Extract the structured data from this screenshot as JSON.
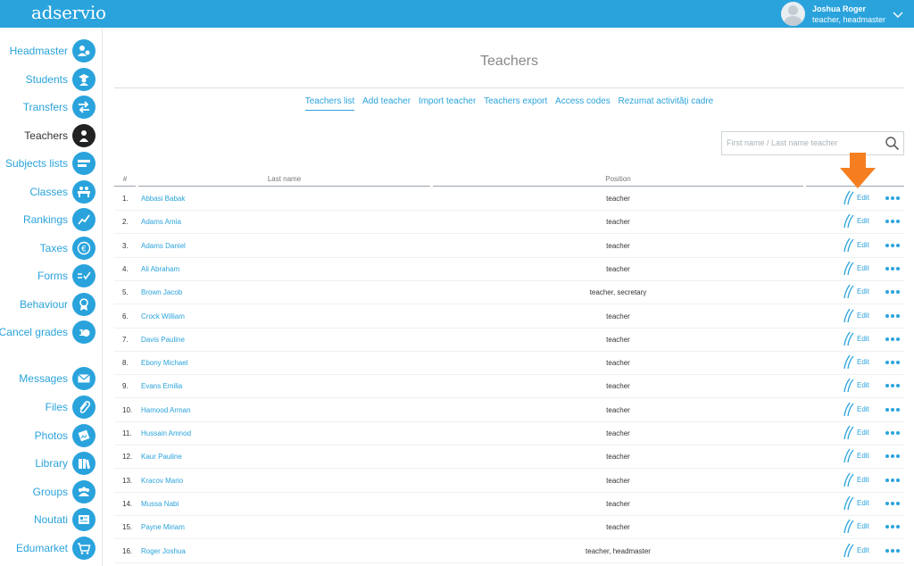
{
  "app": {
    "logo": "adservio"
  },
  "user": {
    "name": "Joshua Roger",
    "role": "teacher, headmaster"
  },
  "colors": {
    "accent": "#2aa3dc",
    "arrow": "#f57f20"
  },
  "sidebar": {
    "items": [
      {
        "label": "Headmaster",
        "icon": "headmaster-icon"
      },
      {
        "label": "Students",
        "icon": "student-icon"
      },
      {
        "label": "Transfers",
        "icon": "transfer-icon"
      },
      {
        "label": "Teachers",
        "icon": "teacher-icon",
        "active": true
      },
      {
        "label": "Subjects lists",
        "icon": "list-icon"
      },
      {
        "label": "Classes",
        "icon": "classroom-icon"
      },
      {
        "label": "Rankings",
        "icon": "chart-icon"
      },
      {
        "label": "Taxes",
        "icon": "euro-icon"
      },
      {
        "label": "Forms",
        "icon": "form-check-icon"
      },
      {
        "label": "Behaviour",
        "icon": "award-icon"
      },
      {
        "label": "Cancel grades",
        "icon": "cancel-grade-icon"
      },
      {
        "label": "Messages",
        "icon": "envelope-icon"
      },
      {
        "label": "Files",
        "icon": "paperclip-icon"
      },
      {
        "label": "Photos",
        "icon": "photo-icon"
      },
      {
        "label": "Library",
        "icon": "book-icon"
      },
      {
        "label": "Groups",
        "icon": "group-icon"
      },
      {
        "label": "Noutati",
        "icon": "news-icon"
      },
      {
        "label": "Edumarket",
        "icon": "cart-icon"
      }
    ]
  },
  "main": {
    "title": "Teachers",
    "tabs": [
      {
        "label": "Teachers list",
        "active": true
      },
      {
        "label": "Add teacher"
      },
      {
        "label": "Import teacher"
      },
      {
        "label": "Teachers export"
      },
      {
        "label": "Access codes"
      },
      {
        "label": "Rezumat activități cadre"
      }
    ],
    "search": {
      "placeholder": "First name / Last name teacher",
      "value": ""
    },
    "table": {
      "headers": {
        "num": "#",
        "last_name": "Last name",
        "position": "Position"
      },
      "edit_label": "Edit",
      "rows": [
        {
          "num": "1.",
          "name": "Abbasi Babak",
          "position": "teacher"
        },
        {
          "num": "2.",
          "name": "Adams Amia",
          "position": "teacher"
        },
        {
          "num": "3.",
          "name": "Adams Daniel",
          "position": "teacher"
        },
        {
          "num": "4.",
          "name": "Ali Abraham",
          "position": "teacher"
        },
        {
          "num": "5.",
          "name": "Brown Jacob",
          "position": "teacher, secretary"
        },
        {
          "num": "6.",
          "name": "Crock William",
          "position": "teacher"
        },
        {
          "num": "7.",
          "name": "Davis Pauline",
          "position": "teacher"
        },
        {
          "num": "8.",
          "name": "Ebony Michael",
          "position": "teacher"
        },
        {
          "num": "9.",
          "name": "Evans Emilia",
          "position": "teacher"
        },
        {
          "num": "10.",
          "name": "Hamood Arman",
          "position": "teacher"
        },
        {
          "num": "11.",
          "name": "Hussain Amnod",
          "position": "teacher"
        },
        {
          "num": "12.",
          "name": "Kaur Pauline",
          "position": "teacher"
        },
        {
          "num": "13.",
          "name": "Kracov Mario",
          "position": "teacher"
        },
        {
          "num": "14.",
          "name": "Mussa Nabi",
          "position": "teacher"
        },
        {
          "num": "15.",
          "name": "Payne Miriam",
          "position": "teacher"
        },
        {
          "num": "16.",
          "name": "Roger Joshua",
          "position": "teacher, headmaster"
        }
      ]
    }
  }
}
